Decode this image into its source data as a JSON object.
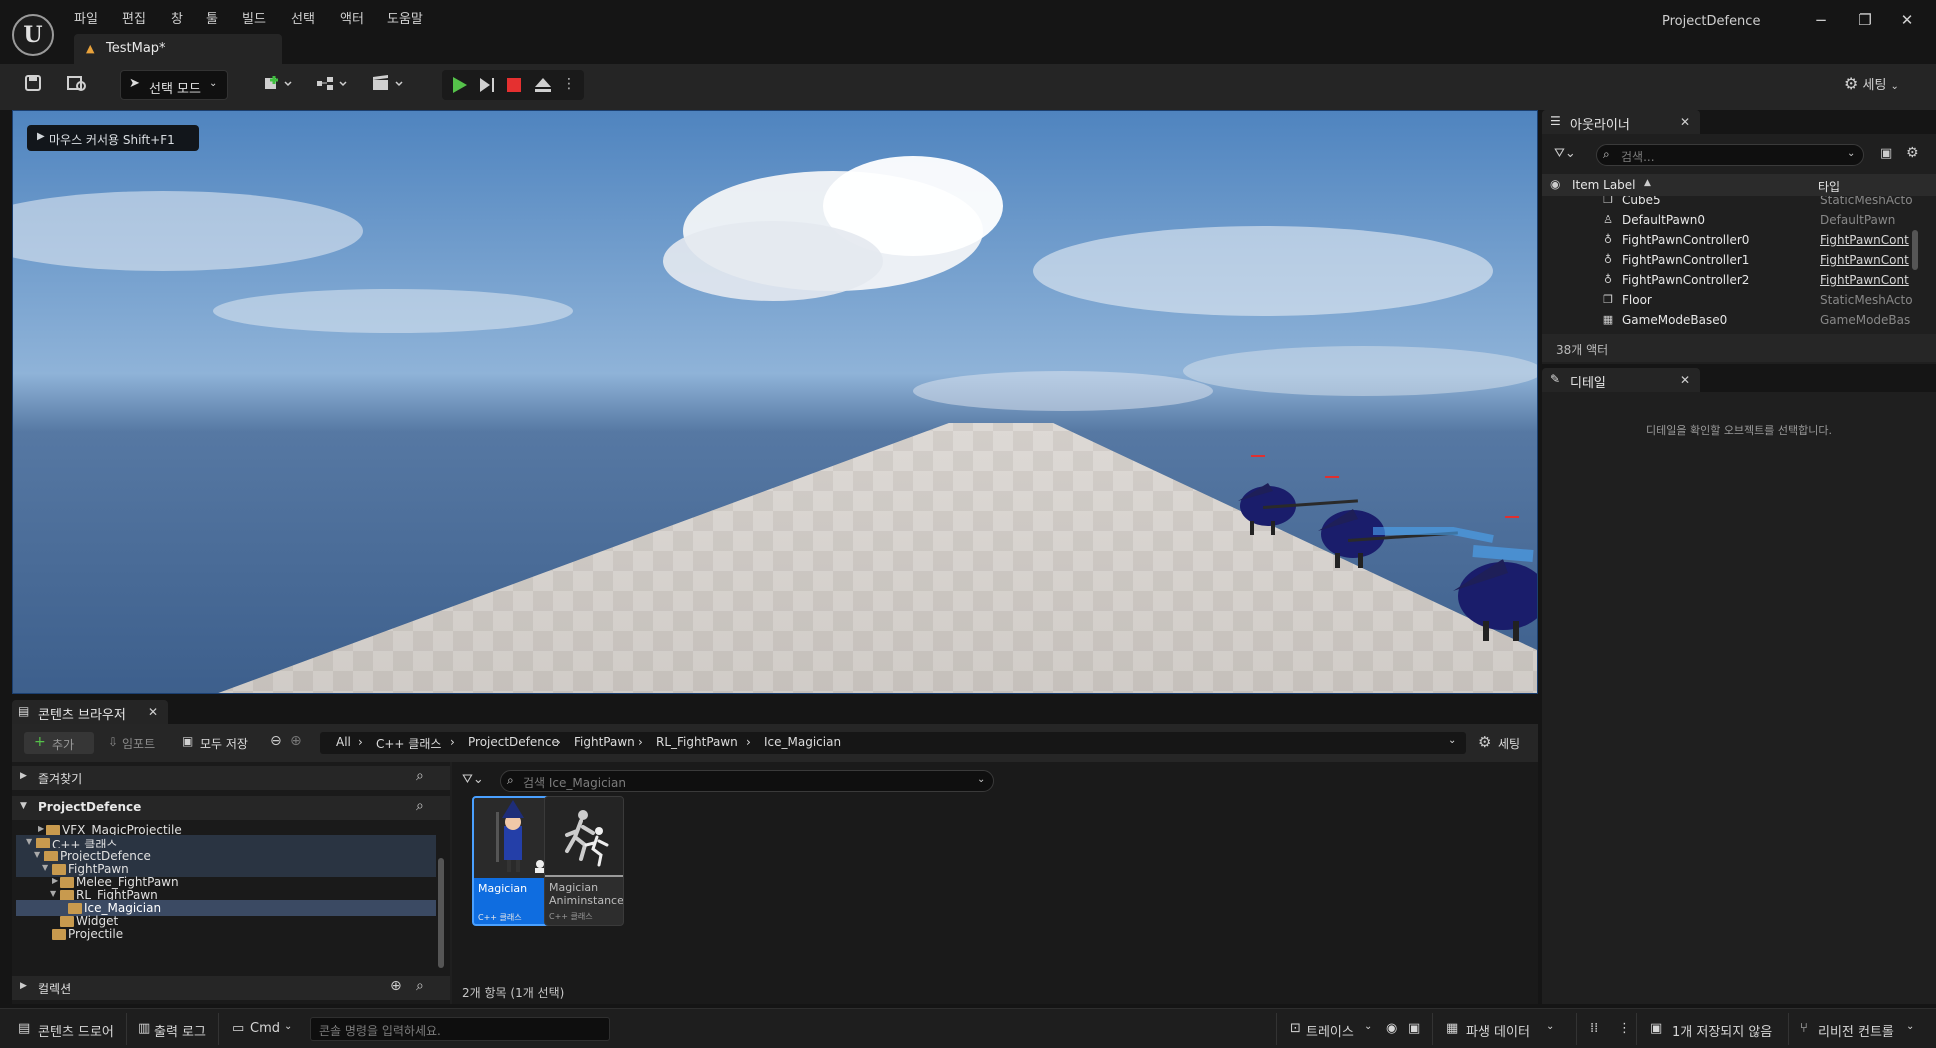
{
  "app": {
    "title": "ProjectDefence",
    "logo": "U"
  },
  "menu": [
    "파일",
    "편집",
    "창",
    "툴",
    "빌드",
    "선택",
    "액터",
    "도움말"
  ],
  "map_tab": {
    "label": "TestMap*"
  },
  "window_controls": {
    "minimize": "−",
    "maximize": "❐",
    "close": "✕"
  },
  "toolbar": {
    "mode_label": "선택 모드",
    "settings_label": "세팅"
  },
  "viewport": {
    "hint_label": "마우스 커서용 Shift+F1"
  },
  "outliner": {
    "tab_label": "아웃라이너",
    "search_placeholder": "검색...",
    "col_label": "Item Label",
    "col_type": "타입",
    "rows": [
      {
        "name": "Cube5",
        "type": "StaticMeshActo",
        "icon": "cube-icon",
        "link": false
      },
      {
        "name": "DefaultPawn0",
        "type": "DefaultPawn",
        "icon": "pawn-icon",
        "link": false
      },
      {
        "name": "FightPawnController0",
        "type": "FightPawnCont",
        "icon": "controller-icon",
        "link": true
      },
      {
        "name": "FightPawnController1",
        "type": "FightPawnCont",
        "icon": "controller-icon",
        "link": true
      },
      {
        "name": "FightPawnController2",
        "type": "FightPawnCont",
        "icon": "controller-icon",
        "link": true
      },
      {
        "name": "Floor",
        "type": "StaticMeshActo",
        "icon": "cube-icon",
        "link": false
      },
      {
        "name": "GameModeBase0",
        "type": "GameModeBas",
        "icon": "gamemode-icon",
        "link": false
      }
    ],
    "footer": "38개 액터"
  },
  "details": {
    "tab_label": "디테일",
    "empty_message": "디테일을 확인할 오브젝트를 선택합니다."
  },
  "content_browser": {
    "tab_label": "콘텐츠 브라우저",
    "add_label": "추가",
    "import_label": "임포트",
    "save_all_label": "모두 저장",
    "settings_label": "세팅",
    "breadcrumb": [
      "All",
      "C++ 클래스",
      "ProjectDefence",
      "FightPawn",
      "RL_FightPawn",
      "Ice_Magician"
    ],
    "favorites_label": "즐겨찾기",
    "project_label": "ProjectDefence",
    "collections_label": "컬렉션",
    "tree": [
      {
        "label": "VFX_MagicProjectile",
        "depth": 1,
        "arrow": "▶",
        "selected": false
      },
      {
        "label": "C++ 클래스",
        "depth": 0,
        "arrow": "▼",
        "selected": false
      },
      {
        "label": "ProjectDefence",
        "depth": 1,
        "arrow": "▼",
        "selected": false
      },
      {
        "label": "FightPawn",
        "depth": 2,
        "arrow": "▼",
        "selected": false
      },
      {
        "label": "Melee_FightPawn",
        "depth": 3,
        "arrow": "▶",
        "selected": false
      },
      {
        "label": "RL_FightPawn",
        "depth": 3,
        "arrow": "▼",
        "selected": false
      },
      {
        "label": "Ice_Magician",
        "depth": 4,
        "arrow": "",
        "selected": true
      },
      {
        "label": "Widget",
        "depth": 3,
        "arrow": "",
        "selected": false
      },
      {
        "label": "Projectile",
        "depth": 2,
        "arrow": "",
        "selected": false
      }
    ],
    "asset_search_placeholder": "검색 Ice_Magician",
    "assets": [
      {
        "name": "Magician",
        "type": "C++ 클래스",
        "selected": true
      },
      {
        "name": "Magician Animinstance",
        "type": "C++ 클래스",
        "selected": false
      }
    ],
    "item_count": "2개 항목 (1개 선택)"
  },
  "statusbar": {
    "content_drawer": "콘텐츠 드로어",
    "output_log": "출력 로그",
    "cmd_label": "Cmd",
    "cmd_placeholder": "콘솔 명령을 입력하세요.",
    "trace_label": "트레이스",
    "derived_data": "파생 데이터",
    "unsaved": "1개 저장되지 않음",
    "revision_control": "리비전 컨트롤"
  }
}
